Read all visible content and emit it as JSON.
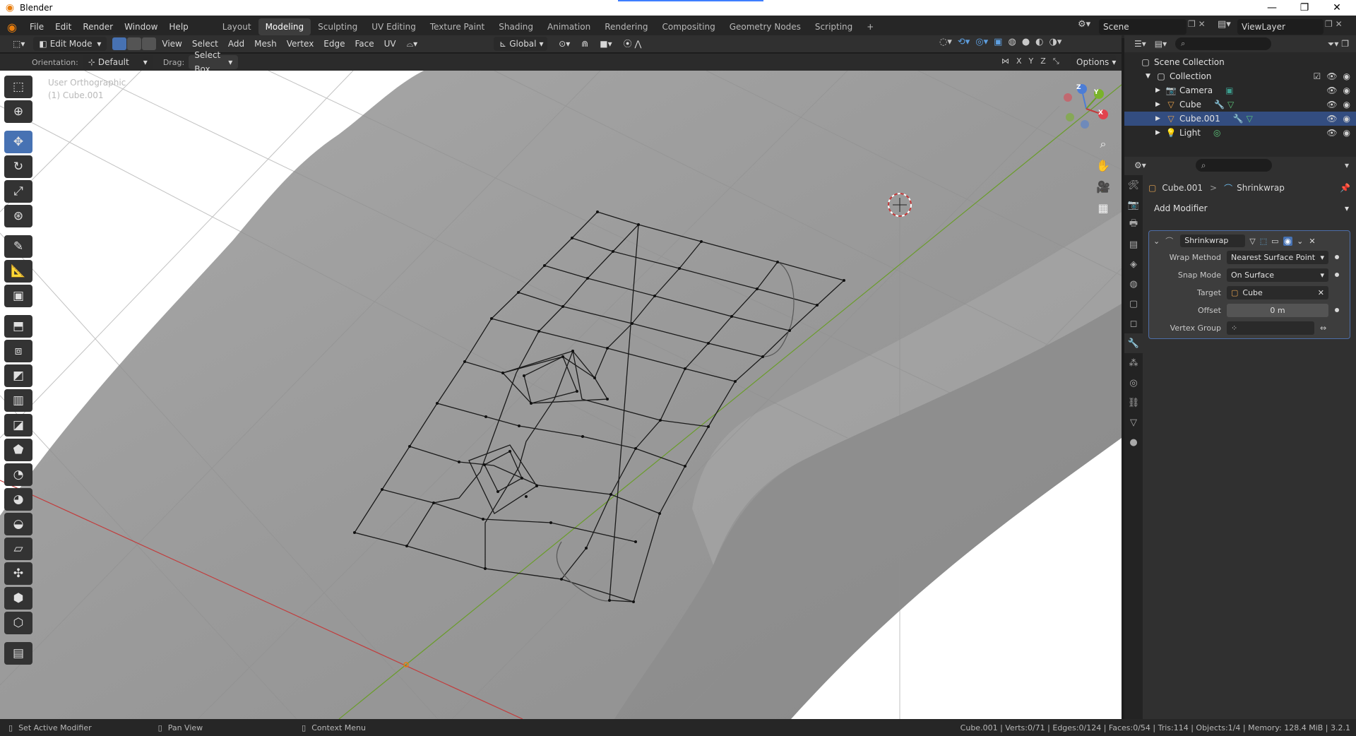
{
  "window": {
    "title": "Blender"
  },
  "menubar": {
    "menus": [
      "File",
      "Edit",
      "Render",
      "Window",
      "Help"
    ],
    "workspaces": [
      "Layout",
      "Modeling",
      "Sculpting",
      "UV Editing",
      "Texture Paint",
      "Shading",
      "Animation",
      "Rendering",
      "Compositing",
      "Geometry Nodes",
      "Scripting"
    ],
    "active_workspace": "Modeling",
    "add_workspace": "+",
    "scene": "Scene",
    "view_layer": "ViewLayer"
  },
  "viewport_header": {
    "mode": "Edit Mode",
    "menus": [
      "View",
      "Select",
      "Add",
      "Mesh",
      "Vertex",
      "Edge",
      "Face",
      "UV"
    ],
    "transform_orientation": "Global"
  },
  "tool_settings": {
    "orientation_label": "Orientation:",
    "orientation_value": "Default",
    "drag_label": "Drag:",
    "drag_value": "Select Box",
    "axis_x": "X",
    "axis_y": "Y",
    "axis_z": "Z",
    "options": "Options"
  },
  "viewport": {
    "view_name": "User Orthographic",
    "object_info": "(1) Cube.001",
    "gizmo": {
      "x": "X",
      "y": "Y",
      "z": "Z"
    }
  },
  "outliner": {
    "root": "Scene Collection",
    "collection": "Collection",
    "items": [
      {
        "name": "Camera",
        "icon": "camera-icon"
      },
      {
        "name": "Cube",
        "icon": "mesh-icon"
      },
      {
        "name": "Cube.001",
        "icon": "mesh-icon",
        "selected": true
      },
      {
        "name": "Light",
        "icon": "light-icon"
      }
    ]
  },
  "properties": {
    "breadcrumb_object": "Cube.001",
    "breadcrumb_separator": ">",
    "breadcrumb_modifier": "Shrinkwrap",
    "add_modifier": "Add Modifier",
    "modifier": {
      "name": "Shrinkwrap",
      "wrap_method_label": "Wrap Method",
      "wrap_method": "Nearest Surface Point",
      "snap_mode_label": "Snap Mode",
      "snap_mode": "On Surface",
      "target_label": "Target",
      "target": "Cube",
      "offset_label": "Offset",
      "offset": "0 m",
      "vertex_group_label": "Vertex Group",
      "vertex_group": ""
    }
  },
  "statusbar": {
    "left_action": "Set Active Modifier",
    "middle_action": "Pan View",
    "right_action": "Context Menu",
    "stats": "Cube.001 | Verts:0/71 | Edges:0/124 | Faces:0/54 | Tris:114 | Objects:1/4 | Memory: 128.4 MiB | 3.2.1"
  },
  "colors": {
    "accent_blue": "#4772b3",
    "selection_row": "#334d80",
    "x_axis_red": "#c23c3c",
    "y_axis_green": "#6a9c2a",
    "blender_orange": "#e87d0d"
  }
}
